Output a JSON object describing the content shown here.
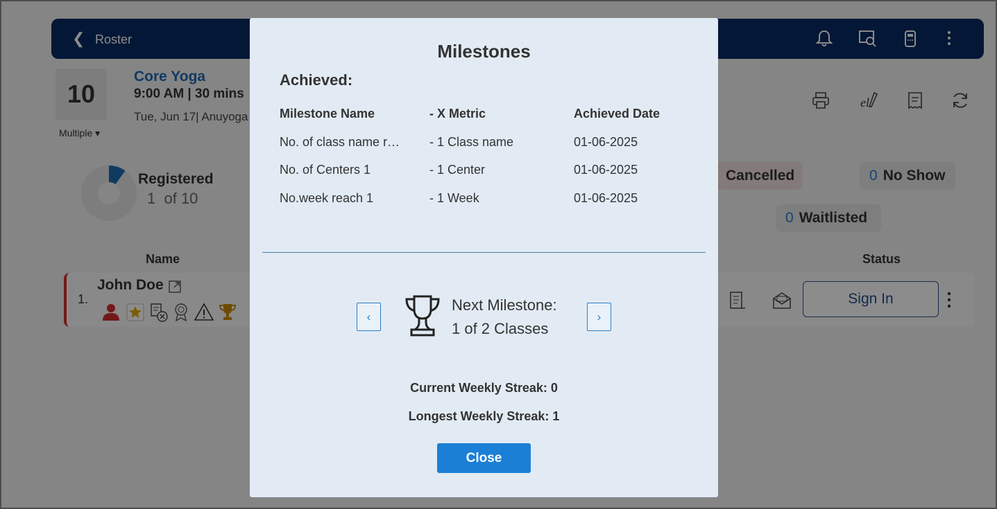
{
  "header": {
    "back_icon": "chevron-left-icon",
    "title": "Roster",
    "icons": [
      "bell-icon",
      "search-document-icon",
      "card-terminal-icon",
      "more-vertical-icon"
    ]
  },
  "class_info": {
    "day_number": "10",
    "multiple_label": "Multiple",
    "name": "Core Yoga",
    "time": "9:00 AM | 30 mins",
    "date_line": "Tue, Jun 17| Anuyoga",
    "action_icons": [
      "printer-icon",
      "signature-icon",
      "receipt-icon",
      "refresh-icon"
    ]
  },
  "stats": {
    "registered_label": "Registered",
    "registered_count": "1",
    "registered_of": "of 10",
    "registered_fraction": 0.1,
    "cancelled_label": "Cancelled",
    "no_show_count": "0",
    "no_show_label": "No Show",
    "waitlisted_count": "0",
    "waitlisted_label": "Waitlisted"
  },
  "table": {
    "col_name": "Name",
    "col_status": "Status",
    "rows": [
      {
        "index": "1.",
        "name": "John Doe",
        "action": "Sign In",
        "icons": [
          "person-icon",
          "star-icon",
          "document-cancel-icon",
          "badge-icon",
          "warning-icon",
          "trophy-icon"
        ]
      }
    ]
  },
  "modal": {
    "title": "Milestones",
    "achieved_label": "Achieved:",
    "columns": [
      "Milestone Name",
      "- X Metric",
      "Achieved Date"
    ],
    "rows": [
      {
        "name": "No. of class name r…",
        "metric": "- 1 Class name",
        "date": "01-06-2025"
      },
      {
        "name": "No. of Centers 1",
        "metric": "- 1 Center",
        "date": "01-06-2025"
      },
      {
        "name": "No.week reach 1",
        "metric": "- 1 Week",
        "date": "01-06-2025"
      }
    ],
    "next_milestone_label": "Next Milestone:",
    "next_milestone_value": "1 of 2 Classes",
    "current_streak": "Current Weekly Streak: 0",
    "longest_streak": "Longest Weekly Streak: 1",
    "close_label": "Close",
    "prev_icon": "chevron-left-icon",
    "next_icon": "chevron-right-icon",
    "trophy_icon": "trophy-icon"
  }
}
